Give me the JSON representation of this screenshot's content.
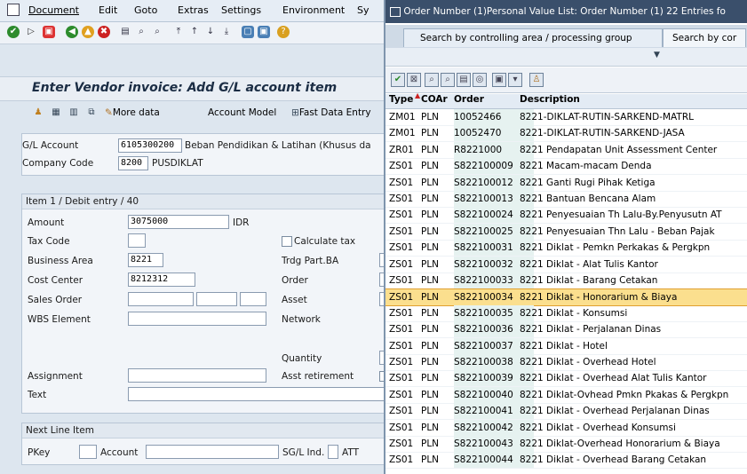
{
  "menu": {
    "items": [
      "Document",
      "Edit",
      "Goto",
      "Extras",
      "Settings",
      "Environment",
      "Sy"
    ]
  },
  "form": {
    "title": "Enter Vendor invoice: Add G/L account item",
    "more_data": "More data",
    "account_model": "Account Model",
    "fast_data_entry": "Fast Data Entry",
    "gl_account_label": "G/L Account",
    "gl_account_value": "6105300200",
    "gl_account_desc": "Beban Pendidikan & Latihan (Khusus da",
    "company_code_label": "Company Code",
    "company_code_value": "8200",
    "company_code_name": "PUSDIKLAT",
    "item_header": "Item 1 / Debit entry / 40",
    "amount_label": "Amount",
    "amount_value": "3075000",
    "currency": "IDR",
    "tax_code_label": "Tax Code",
    "calculate_tax_label": "Calculate tax",
    "business_area_label": "Business Area",
    "business_area_value": "8221",
    "trdg_part_label": "Trdg Part.BA",
    "cost_center_label": "Cost Center",
    "cost_center_value": "8212312",
    "order_label": "Order",
    "sales_order_label": "Sales Order",
    "asset_label": "Asset",
    "wbs_label": "WBS Element",
    "network_label": "Network",
    "quantity_label": "Quantity",
    "assignment_label": "Assignment",
    "asst_retirement_label": "Asst retirement",
    "text_label": "Text",
    "next_line_header": "Next Line Item",
    "pkey_label": "PKey",
    "account_label": "Account",
    "sgl_ind_label": "SG/L Ind.",
    "att_label": "ATT"
  },
  "popup": {
    "title": "Order Number (1)Personal Value List: Order Number (1)  22 Entries fo",
    "tab1": "Search by controlling area / processing group",
    "tab2": "Search by cor",
    "col_type": "Type",
    "col_coar": "COAr",
    "col_order": "Order",
    "col_desc": "Description",
    "rows": [
      {
        "type": "ZM01",
        "coar": "PLN",
        "order": "10052466",
        "desc": "8221-DIKLAT-RUTIN-SARKEND-MATRL"
      },
      {
        "type": "ZM01",
        "coar": "PLN",
        "order": "10052470",
        "desc": "8221-DIKLAT-RUTIN-SARKEND-JASA"
      },
      {
        "type": "ZR01",
        "coar": "PLN",
        "order": "R8221000",
        "desc": "8221 Pendapatan Unit Assessment Center"
      },
      {
        "type": "ZS01",
        "coar": "PLN",
        "order": "S822100009",
        "desc": "8221 Macam-macam Denda"
      },
      {
        "type": "ZS01",
        "coar": "PLN",
        "order": "S822100012",
        "desc": "8221 Ganti Rugi Pihak Ketiga"
      },
      {
        "type": "ZS01",
        "coar": "PLN",
        "order": "S822100013",
        "desc": "8221 Bantuan Bencana Alam"
      },
      {
        "type": "ZS01",
        "coar": "PLN",
        "order": "S822100024",
        "desc": "8221 Penyesuaian Th Lalu-By.Penyusutn AT"
      },
      {
        "type": "ZS01",
        "coar": "PLN",
        "order": "S822100025",
        "desc": "8221 Penyesuaian Thn Lalu - Beban Pajak"
      },
      {
        "type": "ZS01",
        "coar": "PLN",
        "order": "S822100031",
        "desc": "8221 Diklat - Pemkn Perkakas & Pergkpn"
      },
      {
        "type": "ZS01",
        "coar": "PLN",
        "order": "S822100032",
        "desc": "8221 Diklat - Alat Tulis Kantor"
      },
      {
        "type": "ZS01",
        "coar": "PLN",
        "order": "S822100033",
        "desc": "8221 Diklat - Barang Cetakan"
      },
      {
        "type": "ZS01",
        "coar": "PLN",
        "order": "S822100034",
        "desc": "8221 Diklat - Honorarium & Biaya"
      },
      {
        "type": "ZS01",
        "coar": "PLN",
        "order": "S822100035",
        "desc": "8221 Diklat - Konsumsi"
      },
      {
        "type": "ZS01",
        "coar": "PLN",
        "order": "S822100036",
        "desc": "8221 Diklat - Perjalanan Dinas"
      },
      {
        "type": "ZS01",
        "coar": "PLN",
        "order": "S822100037",
        "desc": "8221 Diklat - Hotel"
      },
      {
        "type": "ZS01",
        "coar": "PLN",
        "order": "S822100038",
        "desc": "8221 Diklat - Overhead Hotel"
      },
      {
        "type": "ZS01",
        "coar": "PLN",
        "order": "S822100039",
        "desc": "8221 Diklat - Overhead Alat Tulis Kantor"
      },
      {
        "type": "ZS01",
        "coar": "PLN",
        "order": "S822100040",
        "desc": "8221 Diklat-Ovhead Pmkn Pkakas & Pergkpn"
      },
      {
        "type": "ZS01",
        "coar": "PLN",
        "order": "S822100041",
        "desc": "8221 Diklat - Overhead Perjalanan Dinas"
      },
      {
        "type": "ZS01",
        "coar": "PLN",
        "order": "S822100042",
        "desc": "8221 Diklat - Overhead Konsumsi"
      },
      {
        "type": "ZS01",
        "coar": "PLN",
        "order": "S822100043",
        "desc": "8221 Diklat-Overhead Honorarium & Biaya"
      },
      {
        "type": "ZS01",
        "coar": "PLN",
        "order": "S822100044",
        "desc": "8221 Diklat - Overhead Barang Cetakan"
      }
    ],
    "selected_index": 11
  },
  "colors": {
    "title_bar": "#3a4f6b",
    "selection": "#fbdf8e",
    "order_column": "#e6f2f0"
  }
}
